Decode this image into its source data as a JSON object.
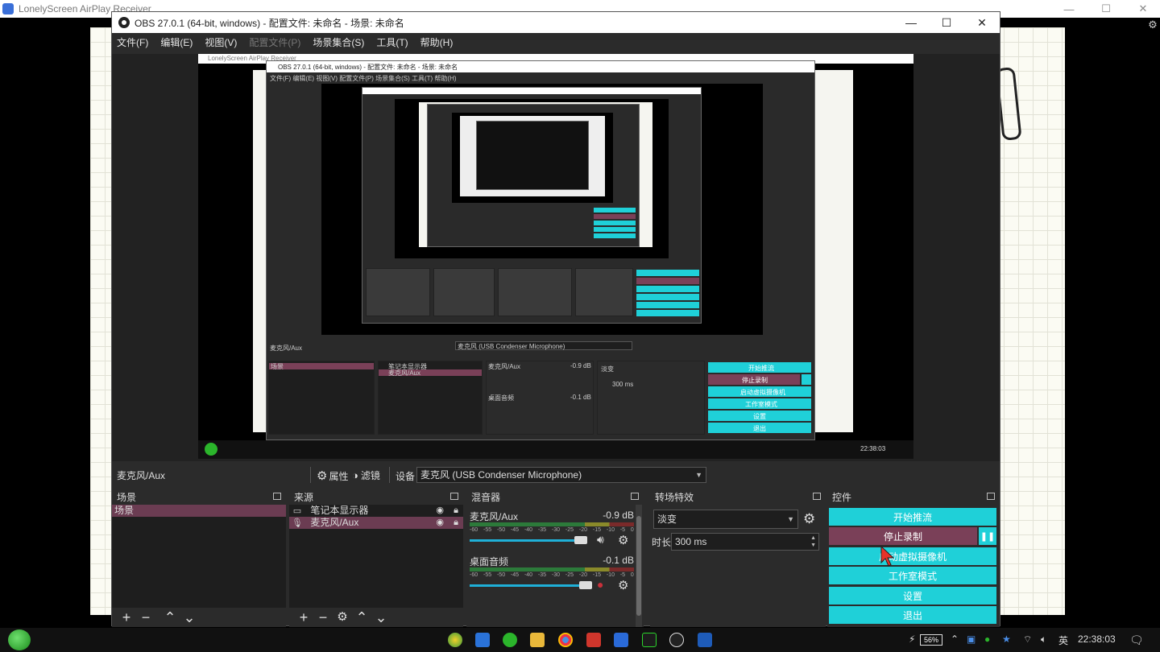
{
  "lonelyscreen": {
    "title": "LonelyScreen AirPlay Receiver"
  },
  "obs": {
    "title": "OBS 27.0.1 (64-bit, windows) - 配置文件: 未命名 - 场景: 未命名",
    "menu": [
      "文件(F)",
      "编辑(E)",
      "视图(V)",
      "配置文件(P)",
      "场景集合(S)",
      "工具(T)",
      "帮助(H)"
    ],
    "menu_disabled_index": 3
  },
  "nested_preview": {
    "title_1": "OBS 27.0.1 (64-bit, windows) - 配置文件: 未命名 - 场景: 未命名",
    "outer_title": "LonelyScreen AirPlay Receiver",
    "menu": "文件(F)  编辑(E)  视图(V)  配置文件(P)  场景集合(S)  工具(T)  帮助(H)",
    "src_name": "麦克风/Aux",
    "device": "麦克风 (USB Condenser Microphone)",
    "scene": "场景",
    "sources": [
      "笔记本显示器",
      "麦克风/Aux"
    ],
    "mic": "麦克风/Aux",
    "mic_db": "-0.9 dB",
    "desk": "桌面音频",
    "desk_db": "-0.1 dB",
    "transition": "淡变",
    "duration": "300 ms",
    "ctrl": [
      "开始推流",
      "停止录制",
      "启动虚拟摄像机",
      "工作室模式",
      "设置",
      "退出"
    ],
    "clock": "22:38:03"
  },
  "source_toolbar": {
    "current_source": "麦克风/Aux",
    "properties_label": "属性",
    "filters_label": "滤镜",
    "device_label": "设备",
    "device_value": "麦克风 (USB Condenser Microphone)"
  },
  "docks": {
    "scenes": {
      "title": "场景",
      "items": [
        "场景"
      ]
    },
    "sources": {
      "title": "来源",
      "items": [
        {
          "name": "笔记本显示器",
          "icon": "monitor-icon"
        },
        {
          "name": "麦克风/Aux",
          "icon": "microphone-icon"
        }
      ]
    },
    "mixer": {
      "title": "混音器",
      "tracks": [
        {
          "name": "麦克风/Aux",
          "db": "-0.9 dB",
          "muted": false
        },
        {
          "name": "桌面音频",
          "db": "-0.1 dB",
          "muted": true
        }
      ],
      "ticks": [
        "-60",
        "-55",
        "-50",
        "-45",
        "-40",
        "-35",
        "-30",
        "-25",
        "-20",
        "-15",
        "-10",
        "-5",
        "0"
      ]
    },
    "transitions": {
      "title": "转场特效",
      "selected": "淡变",
      "duration_label": "时长",
      "duration": "300 ms"
    },
    "controls": {
      "title": "控件",
      "buttons": [
        "开始推流",
        "停止录制",
        "启动虚拟摄像机",
        "工作室模式",
        "设置",
        "退出"
      ]
    }
  },
  "taskbar": {
    "battery": "56%",
    "ime": "英",
    "time": "22:38:03"
  },
  "colors": {
    "accent_cyan": "#1fd0d8",
    "recording_pink": "#7a4058",
    "selection": "#6b3c52"
  }
}
